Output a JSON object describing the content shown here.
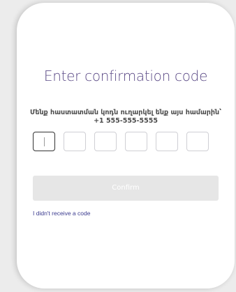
{
  "form": {
    "title": "Enter confirmation code",
    "subtitle": "Մենք հաստատման կոդն ուղարկել ենք այս համարին՝ +1 555-555-5555",
    "code_digits": [
      "",
      "",
      "",
      "",
      "",
      ""
    ],
    "confirm_label": "Confirm",
    "resend_link": "I didn't receive a code"
  },
  "colors": {
    "title": "#5b4a86",
    "button_disabled": "#e6e6e6",
    "link": "#3b3b8f",
    "active_box_border": "#333333"
  }
}
